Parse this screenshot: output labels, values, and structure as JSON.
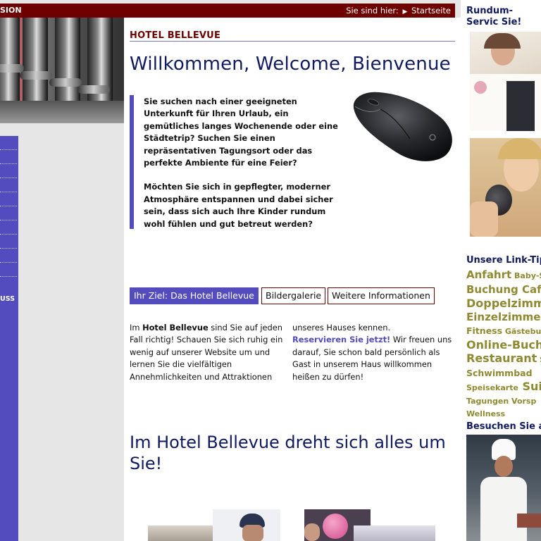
{
  "topbar": {
    "left_text": "SION",
    "location_label": "Sie sind hier:",
    "location_current": "Startseite"
  },
  "leftnav": {
    "label": "USS"
  },
  "main": {
    "hotel_heading": "HOTEL BELLEVUE",
    "welcome_title": "Willkommen, Welcome, Bienvenue",
    "intro": [
      "Sie suchen nach einer geeigneten Unterkunft für Ihren Urlaub, ein gemütliches langes Wochenende oder eine Städtetrip? Suchen Sie einen repräsentativen Tagungsort oder das perfekte Ambiente für eine Feier?",
      "Möchten Sie sich in gepflegter, moderner Atmosphäre entspannen und dabei sicher sein, dass sich auch Ihre Kinder rundum wohl fühlen und gut betreut werden?"
    ],
    "tabs": [
      {
        "label": "Ihr Ziel: Das Hotel Bellevue",
        "active": true
      },
      {
        "label": "Bildergalerie",
        "active": false
      },
      {
        "label": "Weitere Informationen",
        "active": false
      }
    ],
    "col1": {
      "prefix": "Im ",
      "bold": "Hotel Bellevue",
      "rest": " sind Sie auf jeden Fall richtig! Schauen Sie sich ruhig ein wenig auf unserer Website um und lernen Sie die vielfältigen Annehmlichkeiten und Attraktionen"
    },
    "col2": {
      "start": "unseres Hauses kennen.",
      "link": "Reservieren Sie jetzt!",
      "rest": " Wir freuen uns darauf, Sie schon bald persönlich als Gast in unserem Haus willkommen heißen zu dürfen!"
    },
    "subheading": "Im Hotel Bellevue dreht sich alles um Sie!"
  },
  "right": {
    "services_heading": "Rundum-Servic Sie!",
    "link_tips_heading": "Unsere Link-Tip",
    "tags": [
      [
        {
          "text": "Anfahrt",
          "size": "l"
        },
        {
          "text": " Baby-S",
          "size": "s"
        }
      ],
      [
        {
          "text": "Buchung Café",
          "size": "l"
        }
      ],
      [
        {
          "text": "Doppelzimme",
          "size": "xl"
        }
      ],
      [
        {
          "text": "Einzelzimmer",
          "size": "l"
        }
      ],
      [
        {
          "text": "Fitness",
          "size": "m"
        },
        {
          "text": " Gästebuch",
          "size": "s"
        }
      ],
      [
        {
          "text": "Online-Buchu",
          "size": "xl"
        }
      ],
      [
        {
          "text": "Restaurant",
          "size": "xl"
        },
        {
          "text": " S",
          "size": "s"
        }
      ],
      [
        {
          "text": "Schwimmbad",
          "size": "m"
        }
      ],
      [
        {
          "text": "Speisekarte",
          "size": "s"
        },
        {
          "text": " Suite",
          "size": "xl"
        }
      ],
      [
        {
          "text": "Tagungen Vorsp",
          "size": "s"
        }
      ],
      [
        {
          "text": "Wellness",
          "size": "s"
        }
      ]
    ],
    "visit_heading": "Besuchen Sie a"
  },
  "colors": {
    "topbar": "#6e0000",
    "accent_blue": "#524cbf",
    "heading_navy": "#101a60",
    "tag_olive": "#8f8a32"
  }
}
